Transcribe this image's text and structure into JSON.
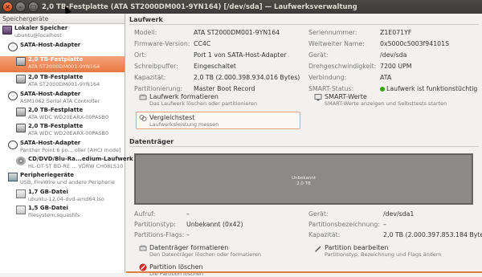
{
  "window": {
    "title": "2,0 TB-Festplatte (ATA ST2000DM001-9YN164) [/dev/sda] — Laufwerksverwaltung"
  },
  "sidebar": {
    "header": "Speichergeräte",
    "items": [
      {
        "t1": "Lokaler Speicher",
        "t2": "ubuntu@localhost",
        "icon": "computer-icon"
      },
      {
        "t1": "SATA-Host-Adapter",
        "t2": "",
        "icon": "controller-icon"
      },
      {
        "t1": "2,0 TB-Festplatte",
        "t2": "ATA ST2000DM001-9YN164",
        "icon": "hard-disk-icon"
      },
      {
        "t1": "2,0 TB-Festplatte",
        "t2": "ATA ST2000DM001-9YN164",
        "icon": "hard-disk-icon"
      },
      {
        "t1": "SATA-Host-Adapter",
        "t2": "ASM1062 Serial ATA Controller",
        "icon": "controller-icon"
      },
      {
        "t1": "2,0 TB-Festplatte",
        "t2": "ATA WDC WD20EARX-00PASB0",
        "icon": "hard-disk-icon"
      },
      {
        "t1": "2,0 TB-Festplatte",
        "t2": "ATA WDC WD20EARX-00PASB0",
        "icon": "hard-disk-icon"
      },
      {
        "t1": "SATA-Host-Adapter",
        "t2": "Panther Point 6 po....oller [AHCI mode]",
        "icon": "controller-icon"
      },
      {
        "t1": "CD/DVD/Blu-Ra...edium-Laufwerk",
        "t2": "HL-DT-ST BD-RE ... VDRW CH08LS10",
        "icon": "optical-drive-icon"
      },
      {
        "t1": "Peripheriegeräte",
        "t2": "USB, FireWire und andere Peripherie",
        "icon": "usb-icon"
      },
      {
        "t1": "1,7 GB-Datei",
        "t2": "ubuntu-12.04-dvd-amd64.iso",
        "icon": "file-icon"
      },
      {
        "t1": "1,5 GB-Datei",
        "t2": "filesystem.squashfs",
        "icon": "file-icon"
      }
    ]
  },
  "drive": {
    "section_title": "Laufwerk",
    "left": [
      {
        "label": "Modell:",
        "value": "ATA ST2000DM001-9YN164"
      },
      {
        "label": "Firmware-Version:",
        "value": "CC4C"
      },
      {
        "label": "Ort:",
        "value": "Port 1 von SATA-Host-Adapter"
      },
      {
        "label": "Schreibpuffer:",
        "value": "Eingeschaltet"
      },
      {
        "label": "Kapazität:",
        "value": "2,0 TB (2.000.398.934.016 Bytes)"
      },
      {
        "label": "Partitionierung:",
        "value": "Master Boot Record"
      }
    ],
    "right": [
      {
        "label": "Seriennummer:",
        "value": "Z1E071YF"
      },
      {
        "label": "Weltweiter Name:",
        "value": "0x5000c5003f94101S"
      },
      {
        "label": "Gerät:",
        "value": "/dev/sda"
      },
      {
        "label": "Drehgeschwindigkeit:",
        "value": "7200 UPM"
      },
      {
        "label": "Verbindung:",
        "value": "ATA"
      },
      {
        "label": "SMART-Status:",
        "value": "Laufwerk ist funktionstüchtig"
      }
    ],
    "actions": {
      "format_title": "Laufwerk formatieren",
      "format_desc": "Das Laufwerk löschen oder partitionieren",
      "smart_title": "SMART-Werte",
      "smart_desc": "SMART-Werte anzeigen und Selbsttests starten",
      "bench_title": "Vergleichstest",
      "bench_desc": "Laufwerksleistung messen"
    }
  },
  "volumes": {
    "section_title": "Datenträger",
    "disk_label1": "Unbekannt",
    "disk_label2": "2,0 TB",
    "left": [
      {
        "label": "Aufruf:",
        "value": "–"
      },
      {
        "label": "Partitionstyp:",
        "value": "Unbekannt (0x42)"
      },
      {
        "label": "Partitions-Flags:",
        "value": "–"
      }
    ],
    "right": [
      {
        "label": "Gerät:",
        "value": "/dev/sda1"
      },
      {
        "label": "Partitionsbezeichnung:",
        "value": "–"
      },
      {
        "label": "Kapazität:",
        "value": "2,0 TB (2.000.397.853.184 Bytes)"
      }
    ],
    "actions": {
      "format_title": "Datenträger formatieren",
      "format_desc": "Den Datenträger löschen oder formatieren",
      "edit_title": "Partition bearbeiten",
      "edit_desc": "Partitionstyp, Bezeichnung und Flags ändern",
      "delete_title": "Partition löschen",
      "delete_desc": "Die Partition löschen"
    }
  }
}
